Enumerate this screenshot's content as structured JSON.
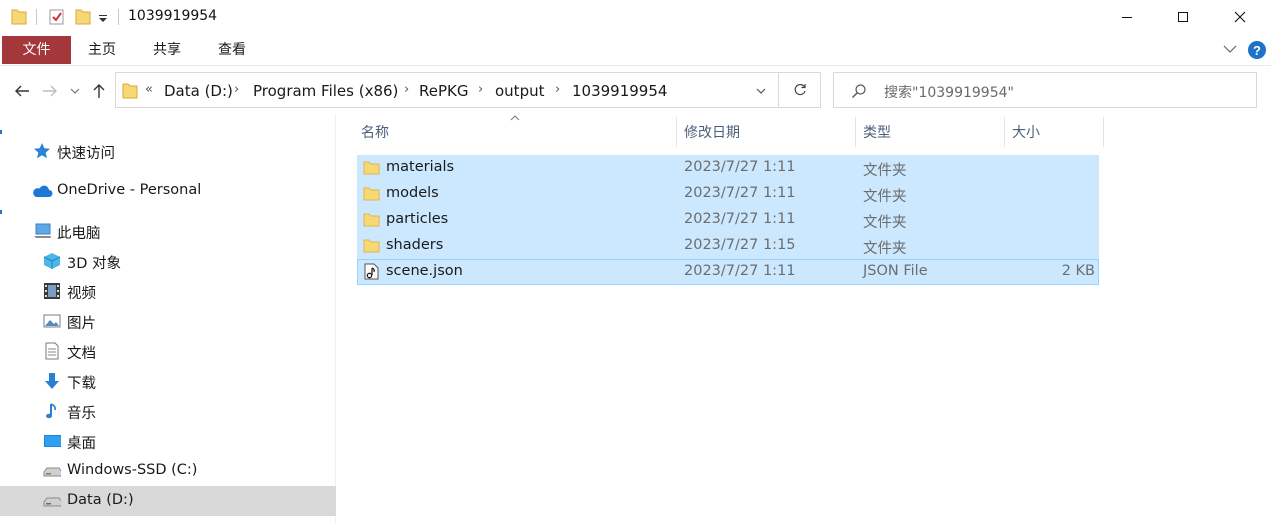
{
  "window": {
    "title": "1039919954"
  },
  "ribbon": {
    "tabs": [
      "文件",
      "主页",
      "共享",
      "查看"
    ]
  },
  "address": {
    "overflow": "«",
    "crumbs": [
      "Data (D:)",
      "Program Files (x86)",
      "RePKG",
      "output",
      "1039919954"
    ]
  },
  "search": {
    "placeholder": "搜索\"1039919954\""
  },
  "sidebar": {
    "quick_access": "快速访问",
    "onedrive": "OneDrive - Personal",
    "this_pc": "此电脑",
    "items": [
      "3D 对象",
      "视频",
      "图片",
      "文档",
      "下载",
      "音乐",
      "桌面",
      "Windows-SSD (C:)",
      "Data (D:)"
    ]
  },
  "columns": {
    "name": "名称",
    "modified": "修改日期",
    "type": "类型",
    "size": "大小"
  },
  "files": [
    {
      "name": "materials",
      "modified": "2023/7/27 1:11",
      "type": "文件夹",
      "size": "",
      "icon": "folder-icon"
    },
    {
      "name": "models",
      "modified": "2023/7/27 1:11",
      "type": "文件夹",
      "size": "",
      "icon": "folder-icon"
    },
    {
      "name": "particles",
      "modified": "2023/7/27 1:11",
      "type": "文件夹",
      "size": "",
      "icon": "folder-icon"
    },
    {
      "name": "shaders",
      "modified": "2023/7/27 1:15",
      "type": "文件夹",
      "size": "",
      "icon": "folder-icon"
    },
    {
      "name": "scene.json",
      "modified": "2023/7/27 1:11",
      "type": "JSON File",
      "size": "2 KB",
      "icon": "json-file-icon"
    }
  ],
  "colors": {
    "file_tab": "#a4373a",
    "selection": "#cce8ff",
    "selection_border": "#99d1ff",
    "folder": "#f8d775",
    "accent": "#0078d7"
  }
}
